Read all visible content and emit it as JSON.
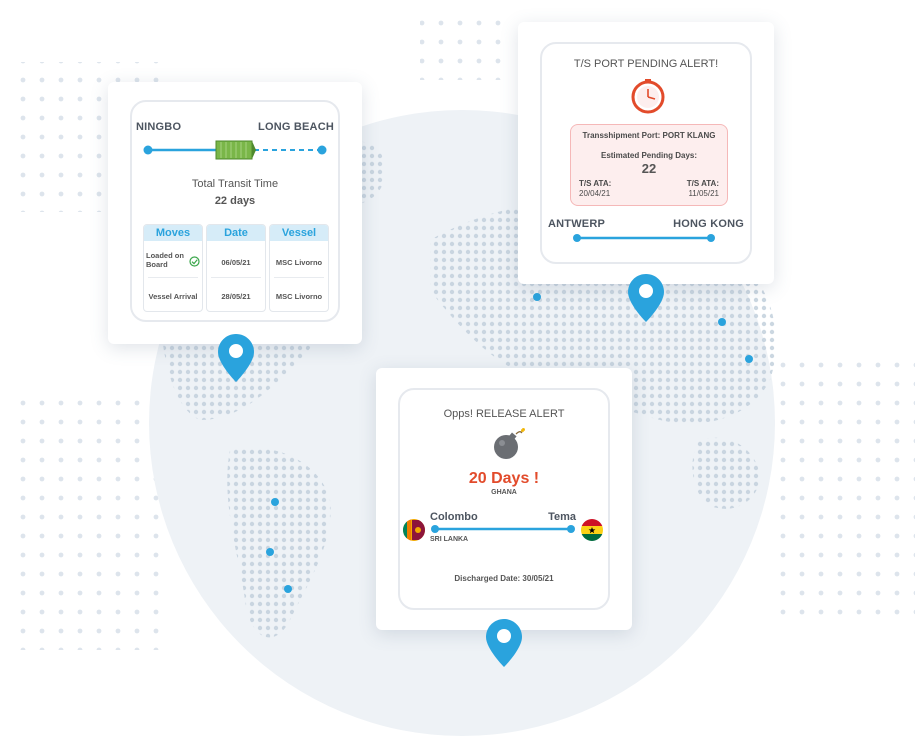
{
  "colors": {
    "accent": "#2aa3dd",
    "alert_red": "#e24b2b",
    "alert_box_bg": "#fdeeee",
    "alert_box_border": "#f5b8b8",
    "globe": "#eef2f6",
    "map_dots": "#c7d3de"
  },
  "transit_card": {
    "origin": "NINGBO",
    "destination": "LONG BEACH",
    "transit_label": "Total Transit Time",
    "transit_value": "22 days",
    "table": {
      "headers": [
        "Moves",
        "Date",
        "Vessel"
      ],
      "rows": [
        {
          "move": "Loaded on Board",
          "date": "06/05/21",
          "vessel": "MSC Livorno"
        },
        {
          "move": "Vessel Arrival",
          "date": "28/05/21",
          "vessel": "MSC Livorno"
        }
      ]
    },
    "icons": [
      "ship-icon",
      "check-icon"
    ]
  },
  "ts_alert_card": {
    "title": "T/S PORT PENDING ALERT!",
    "transshipment_port": "Transshipment Port: PORT KLANG",
    "pending_label": "Estimated Pending Days:",
    "pending_value": "22",
    "ata_left_label": "T/S ATA:",
    "ata_left_date": "20/04/21",
    "ata_right_label": "T/S ATA:",
    "ata_right_date": "11/05/21",
    "origin": "ANTWERP",
    "destination": "HONG KONG",
    "icons": [
      "clock-icon"
    ]
  },
  "release_card": {
    "title": "Opps! RELEASE ALERT",
    "days": "20 Days !",
    "days_country": "GHANA",
    "origin": "Colombo",
    "origin_country": "SRI LANKA",
    "destination": "Tema",
    "discharged": "Discharged Date: 30/05/21",
    "icons": [
      "bomb-icon",
      "sri-lanka-flag-icon",
      "ghana-flag-icon"
    ]
  }
}
